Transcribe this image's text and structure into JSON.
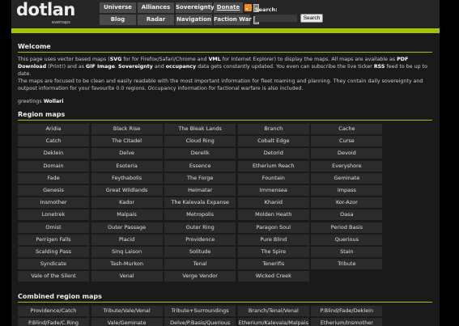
{
  "header": {
    "logo_text": "dotlan",
    "logo_sub": "evemaps",
    "nav_row1": [
      "Universe",
      "Alliances",
      "Sovereignty",
      "Donate"
    ],
    "nav_row2": [
      "Blog",
      "Radar",
      "Navigation",
      "Faction War"
    ],
    "search_label": "Search:",
    "search_value": "",
    "search_button": "Search"
  },
  "welcome": {
    "title": "Welcome",
    "p1": [
      {
        "t": "This page uses vector based maps (",
        "b": false
      },
      {
        "t": "SVG",
        "b": true
      },
      {
        "t": " for for Firefox/Safari/Chrome and ",
        "b": false
      },
      {
        "t": "VML",
        "b": true
      },
      {
        "t": " for Internet Explorer) to display the maps. All maps are available as ",
        "b": false
      },
      {
        "t": "PDF Download",
        "b": true
      },
      {
        "t": " (Print!) and as ",
        "b": false
      },
      {
        "t": "GIF Image",
        "b": true
      },
      {
        "t": ". ",
        "b": false
      },
      {
        "t": "Sovereignty",
        "b": true
      },
      {
        "t": " and ",
        "b": false
      },
      {
        "t": "occupancy",
        "b": true
      },
      {
        "t": " data gets constantly updated. You even can subscribe the live ticker ",
        "b": false
      },
      {
        "t": "RSS",
        "b": true
      },
      {
        "t": " feed to be up to date.",
        "b": false
      }
    ],
    "p2": "The maps are focused to be clean and easily readable with the most important information for fleet roaming and planning. They contain daily sovereignty and outpost information for your favourite 0.0 regions. Occupancy information for factional warfare is also included.",
    "greeting_prefix": "greetings ",
    "greeting_name": "Wollari"
  },
  "region_maps": {
    "title": "Region maps",
    "items": [
      "Aridia",
      "Black Rise",
      "The Bleak Lands",
      "Branch",
      "Cache",
      "Catch",
      "The Citadel",
      "Cloud Ring",
      "Cobalt Edge",
      "Curse",
      "Deklein",
      "Delve",
      "Derelik",
      "Detorid",
      "Devoid",
      "Domain",
      "Esoteria",
      "Essence",
      "Etherium Reach",
      "Everyshore",
      "Fade",
      "Feythabolis",
      "The Forge",
      "Fountain",
      "Geminate",
      "Genesis",
      "Great Wildlands",
      "Heimatar",
      "Immensea",
      "Impass",
      "Insmother",
      "Kador",
      "The Kalevala Expanse",
      "Khanid",
      "Kor-Azor",
      "Lonetrek",
      "Malpais",
      "Metropolis",
      "Molden Heath",
      "Oasa",
      "Omist",
      "Outer Passage",
      "Outer Ring",
      "Paragon Soul",
      "Period Basis",
      "Perrigen Falls",
      "Placid",
      "Providence",
      "Pure Blind",
      "Querious",
      "Scalding Pass",
      "Sinq Laison",
      "Solitude",
      "The Spire",
      "Stain",
      "Syndicate",
      "Tash-Murkon",
      "Tenal",
      "Tenerifis",
      "Tribute",
      "Vale of the Silent",
      "Venal",
      "Verge Vendor",
      "Wicked Creek"
    ]
  },
  "combined_maps": {
    "title": "Combined region maps",
    "items": [
      "Providence/Catch",
      "Tribute/Vale/Venal",
      "Tribute+Surroundings",
      "Branch/Tenal/Venal",
      "P.Blind/Fade/Deklein",
      "P.Blind/Fade/C.Ring",
      "Vale/Geminate",
      "Delve/P.Basis/Querious",
      "Etherium/Kalevala/Malpais",
      "Etherium/Insmother"
    ]
  }
}
